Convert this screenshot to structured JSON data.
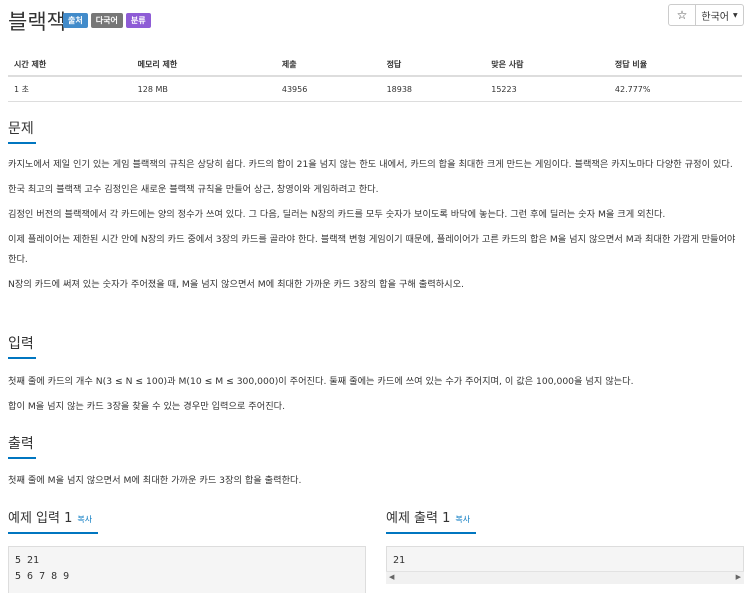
{
  "problem": {
    "title": "블랙잭",
    "badges": [
      "출처",
      "다국어",
      "분류"
    ],
    "star_icon": "star-icon",
    "language": "한국어"
  },
  "stats": {
    "headers": [
      "시간 제한",
      "메모리 제한",
      "제출",
      "정답",
      "맞은 사람",
      "정답 비율"
    ],
    "values": [
      "1 초",
      "128 MB",
      "43956",
      "18938",
      "15223",
      "42.777%"
    ]
  },
  "sections": {
    "problem_title": "문제",
    "problem_paragraphs": [
      "카지노에서 제일 인기 있는 게임 블랙잭의 규칙은 상당히 쉽다. 카드의 합이 21을 넘지 않는 한도 내에서, 카드의 합을 최대한 크게 만드는 게임이다. 블랙잭은 카지노마다 다양한 규정이 있다.",
      "한국 최고의 블랙잭 고수 김정인은 새로운 블랙잭 규칙을 만들어 상근, 창영이와 게임하려고 한다.",
      "김정인 버전의 블랙잭에서 각 카드에는 양의 정수가 쓰여 있다. 그 다음, 딜러는 N장의 카드를 모두 숫자가 보이도록 바닥에 놓는다. 그런 후에 딜러는 숫자 M을 크게 외친다.",
      "이제 플레이어는 제한된 시간 안에 N장의 카드 중에서 3장의 카드를 골라야 한다. 블랙잭 변형 게임이기 때문에, 플레이어가 고른 카드의 합은 M을 넘지 않으면서 M과 최대한 가깝게 만들어야 한다.",
      "N장의 카드에 써져 있는 숫자가 주어졌을 때, M을 넘지 않으면서 M에 최대한 가까운 카드 3장의 합을 구해 출력하시오."
    ],
    "input_title": "입력",
    "input_paragraphs": [
      "첫째 줄에 카드의 개수 N(3 ≤ N ≤ 100)과 M(10 ≤ M ≤ 300,000)이 주어진다. 둘째 줄에는 카드에 쓰여 있는 수가 주어지며, 이 값은 100,000을 넘지 않는다.",
      "합이 M을 넘지 않는 카드 3장을 찾을 수 있는 경우만 입력으로 주어진다."
    ],
    "output_title": "출력",
    "output_paragraphs": [
      "첫째 줄에 M을 넘지 않으면서 M에 최대한 가까운 카드 3장의 합을 출력한다."
    ]
  },
  "samples": {
    "input_title": "예제 입력 1",
    "output_title": "예제 출력 1",
    "copy_label": "복사",
    "input_text": "5 21\n5 6 7 8 9",
    "output_text": "21"
  }
}
